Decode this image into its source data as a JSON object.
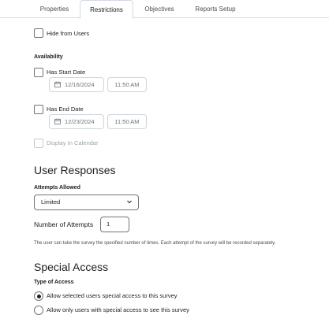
{
  "tabs": [
    {
      "label": "Properties",
      "active": false
    },
    {
      "label": "Restrictions",
      "active": true
    },
    {
      "label": "Objectives",
      "active": false
    },
    {
      "label": "Reports Setup",
      "active": false
    }
  ],
  "hide_from_users": {
    "label": "Hide from Users",
    "checked": false
  },
  "availability": {
    "heading": "Availability",
    "start": {
      "label": "Has Start Date",
      "checked": false,
      "date": "12/16/2024",
      "time": "11:50 AM"
    },
    "end": {
      "label": "Has End Date",
      "checked": false,
      "date": "12/23/2024",
      "time": "11:50 AM"
    },
    "display_in_calendar": {
      "label": "Display In Calendar",
      "checked": false,
      "disabled": true
    }
  },
  "user_responses": {
    "heading": "User Responses",
    "attempts_allowed_label": "Attempts Allowed",
    "attempts_allowed_value": "Limited",
    "number_of_attempts_label": "Number of Attempts",
    "number_of_attempts_value": "1",
    "help_text": "The user can take the survey the specified number of times. Each attempt of the survey will be recorded separately."
  },
  "special_access": {
    "heading": "Special Access",
    "type_label": "Type of Access",
    "options": [
      {
        "label": "Allow selected users special access to this survey",
        "checked": true
      },
      {
        "label": "Allow only users with special access to see this survey",
        "checked": false
      }
    ]
  },
  "colors": {
    "text": "#202122",
    "border": "#6e7477",
    "muted": "#9ea3a6"
  },
  "icons": {
    "date": "calendar-icon",
    "select": "chevron-down-icon"
  }
}
